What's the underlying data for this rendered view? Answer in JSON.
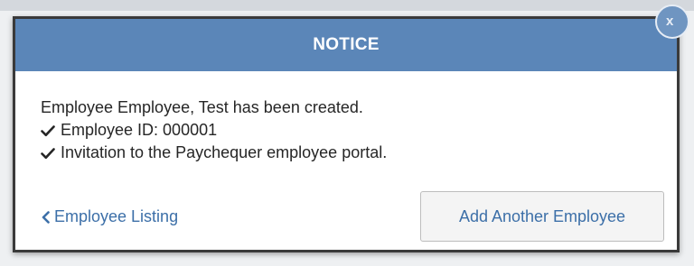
{
  "dialog": {
    "title": "NOTICE",
    "close_label": "x",
    "message": "Employee Employee, Test has been created.",
    "items": [
      {
        "icon": "checkmark-icon",
        "text": "Employee ID: 000001"
      },
      {
        "icon": "checkmark-icon",
        "text": "Invitation to the Paychequer employee portal."
      }
    ],
    "back_link": {
      "icon": "chevron-left-icon",
      "label": "Employee Listing"
    },
    "primary_button": "Add Another Employee"
  },
  "colors": {
    "header_bg": "#5b86b8",
    "link": "#3c6fa8",
    "button_bg": "#f4f4f4"
  }
}
